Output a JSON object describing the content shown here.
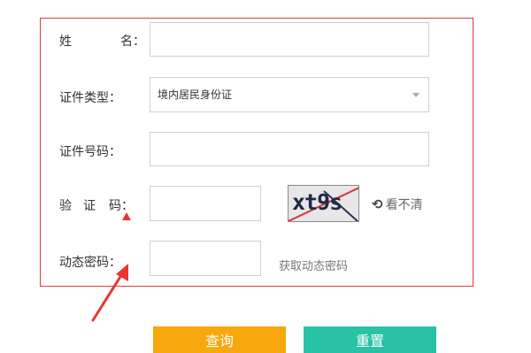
{
  "form": {
    "name_label_first": "姓",
    "name_label_last": "名：",
    "id_type_label": "证件类型：",
    "id_type_value": "境内居民身份证",
    "id_number_label": "证件号码：",
    "captcha_label_1": "验",
    "captcha_label_2": "证",
    "captcha_label_3": "码：",
    "captcha_text": "xt9s",
    "refresh_label": "看不清",
    "dynamic_code_label": "动态密码：",
    "get_dynamic_code_link": "获取动态密码"
  },
  "buttons": {
    "query_label": "查询",
    "reset_label": "重置"
  },
  "colors": {
    "frame_border": "#e0393e",
    "query_button": "#f7a80c",
    "reset_button": "#29c2a6",
    "annotation_arrow": "#e8362f"
  },
  "icons": {
    "refresh": "refresh-icon",
    "select_caret": "chevron-down-icon",
    "annotation": "arrow-annotation-icon"
  }
}
